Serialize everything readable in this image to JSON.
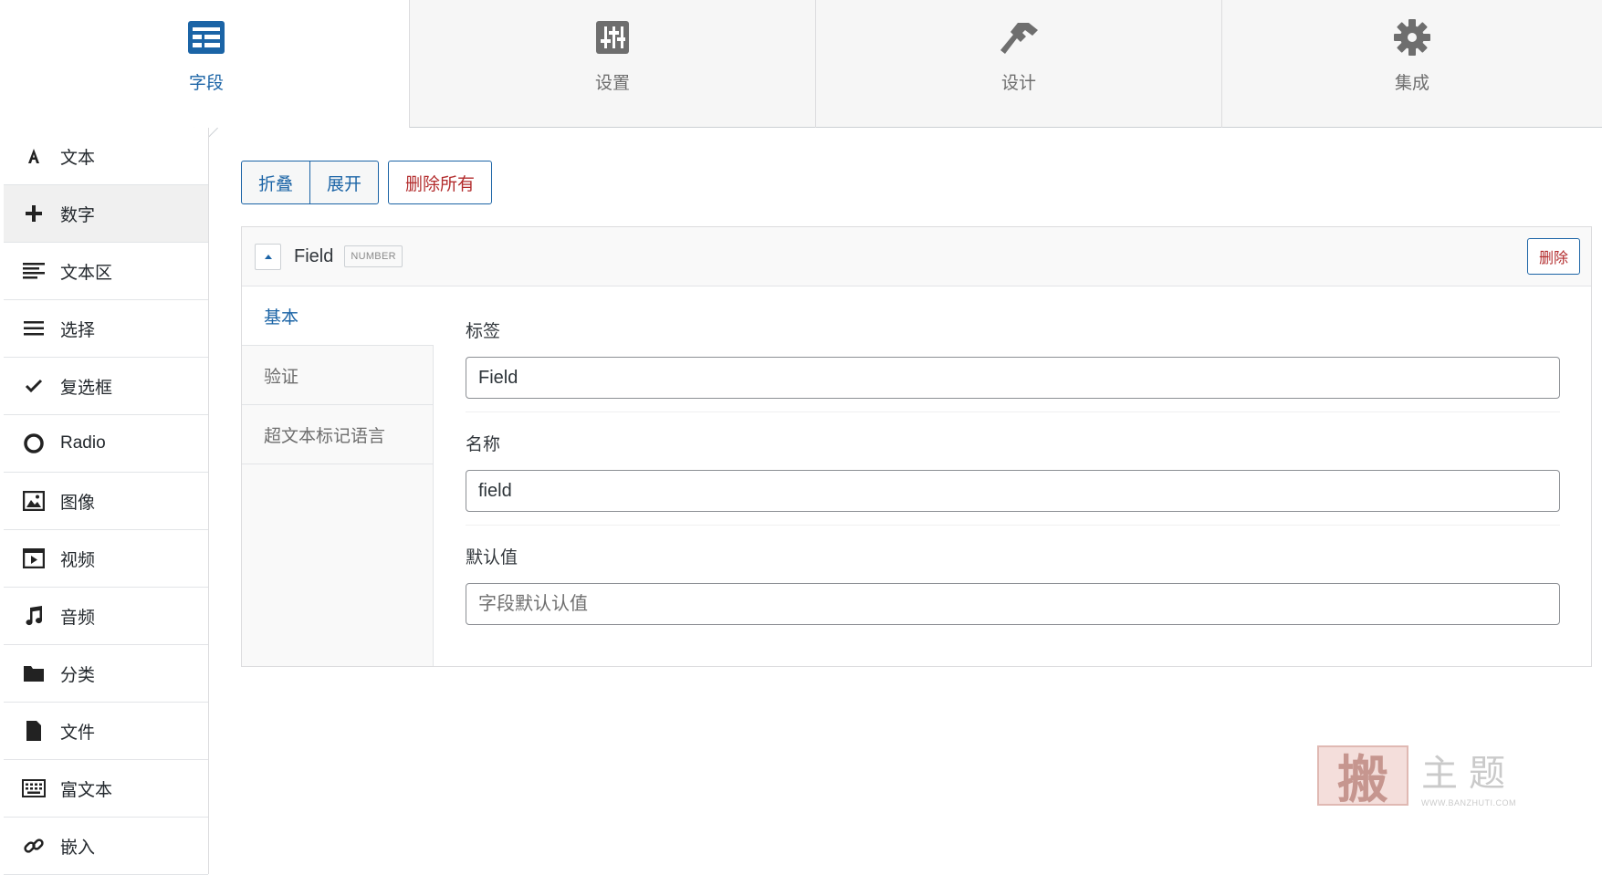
{
  "top_tabs": [
    {
      "label": "字段",
      "icon": "field-layout-icon",
      "active": true
    },
    {
      "label": "设置",
      "icon": "sliders-icon",
      "active": false
    },
    {
      "label": "设计",
      "icon": "hammer-icon",
      "active": false
    },
    {
      "label": "集成",
      "icon": "gear-icon",
      "active": false
    }
  ],
  "sidebar": {
    "items": [
      {
        "label": "文本",
        "icon": "text-a-icon"
      },
      {
        "label": "数字",
        "icon": "plus-icon"
      },
      {
        "label": "文本区",
        "icon": "paragraph-icon"
      },
      {
        "label": "选择",
        "icon": "list-icon"
      },
      {
        "label": "复选框",
        "icon": "checkmark-icon"
      },
      {
        "label": "Radio",
        "icon": "radio-circle-icon"
      },
      {
        "label": "图像",
        "icon": "image-icon"
      },
      {
        "label": "视频",
        "icon": "video-icon"
      },
      {
        "label": "音频",
        "icon": "music-note-icon"
      },
      {
        "label": "分类",
        "icon": "folder-icon"
      },
      {
        "label": "文件",
        "icon": "file-icon"
      },
      {
        "label": "富文本",
        "icon": "keyboard-icon"
      },
      {
        "label": "嵌入",
        "icon": "link-icon"
      }
    ]
  },
  "toolbar": {
    "collapse_label": "折叠",
    "expand_label": "展开",
    "delete_all_label": "删除所有"
  },
  "field": {
    "title": "Field",
    "type_badge": "NUMBER",
    "delete_label": "删除",
    "tabs": [
      "基本",
      "验证",
      "超文本标记语言"
    ],
    "form": {
      "label_label": "标签",
      "label_value": "Field",
      "name_label": "名称",
      "name_value": "field",
      "default_label": "默认值",
      "default_placeholder": "字段默认认值"
    }
  },
  "watermark": {
    "seal": "搬",
    "title": "主题",
    "url": "WWW.BANZHUTI.COM"
  },
  "colors": {
    "accent": "#1b64a6",
    "danger": "#b32d2e",
    "border": "#dcdcde"
  }
}
